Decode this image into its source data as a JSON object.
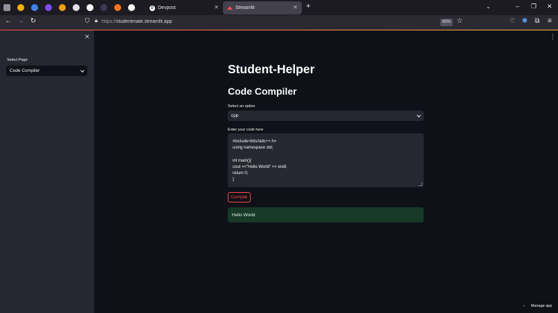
{
  "browser": {
    "tabs": [
      {
        "title": "Devpost",
        "favicon": "D"
      },
      {
        "title": "Streamlit",
        "active": true
      }
    ],
    "url_prefix": "https://",
    "url_host": "studentmate.streamlit.app",
    "zoom": "80%",
    "pinned_tab_colors": [
      "#8f8f9d",
      "#f5b200",
      "#3b82f6",
      "#7c4dff",
      "#f59e0b",
      "#dfe1e5",
      "#ffffff",
      "#3a3a5a",
      "#f97316",
      "#ffffff"
    ],
    "window_controls": [
      "–",
      "❐",
      "✕"
    ]
  },
  "sidebar": {
    "select_label": "Select Page",
    "select_value": "Code Compiler"
  },
  "main": {
    "title": "Student-Helper",
    "subtitle": "Code Compiler",
    "option_label": "Select an option",
    "option_value": "cpp",
    "code_label": "Enter your code here",
    "code_lines": [
      "#include<bits/stdc++.h>",
      "using namespace std;",
      "",
      "int main(){",
      "cout <<\"Hello World\" << endl;",
      "return 0;",
      "}"
    ],
    "compile_label": "Compile",
    "output": "Hello World"
  },
  "footer": {
    "manage_app": "Manage app"
  },
  "colors": {
    "accent": "#ff4b4b",
    "app_bg": "#0e1117",
    "sidebar_bg": "#262730",
    "success_bg": "#173928"
  }
}
